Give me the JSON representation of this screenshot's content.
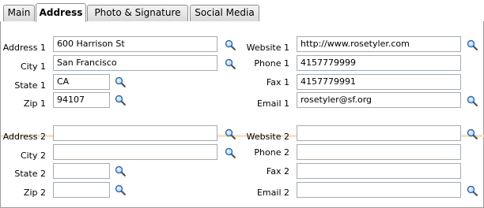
{
  "tabs": [
    {
      "label": "Main"
    },
    {
      "label": "Address"
    },
    {
      "label": "Photo & Signature"
    },
    {
      "label": "Social Media"
    }
  ],
  "active_tab": "Address",
  "address1": {
    "address": {
      "label": "Address 1",
      "value": "600 Harrison St"
    },
    "city": {
      "label": "City 1",
      "value": "San Francisco"
    },
    "state": {
      "label": "State 1",
      "value": "CA"
    },
    "zip": {
      "label": "Zip 1",
      "value": "94107"
    },
    "website": {
      "label": "Website 1",
      "value": "http://www.rosetyler.com"
    },
    "phone": {
      "label": "Phone 1",
      "value": "4157779999"
    },
    "fax": {
      "label": "Fax 1",
      "value": "4157779991"
    },
    "email": {
      "label": "Email 1",
      "value": "rosetyler@sf.org"
    }
  },
  "address2": {
    "address": {
      "label": "Address 2",
      "value": ""
    },
    "city": {
      "label": "City 2",
      "value": ""
    },
    "state": {
      "label": "State 2",
      "value": ""
    },
    "zip": {
      "label": "Zip 2",
      "value": ""
    },
    "website": {
      "label": "Website 2",
      "value": ""
    },
    "phone": {
      "label": "Phone 2",
      "value": ""
    },
    "fax": {
      "label": "Fax 2",
      "value": ""
    },
    "email": {
      "label": "Email 2",
      "value": ""
    }
  },
  "icons": {
    "lookup": "magnifier-icon"
  },
  "colors": {
    "separator": "#f4e3c9",
    "border": "#9c9c9c",
    "magnifier": "#2a6bb8"
  }
}
